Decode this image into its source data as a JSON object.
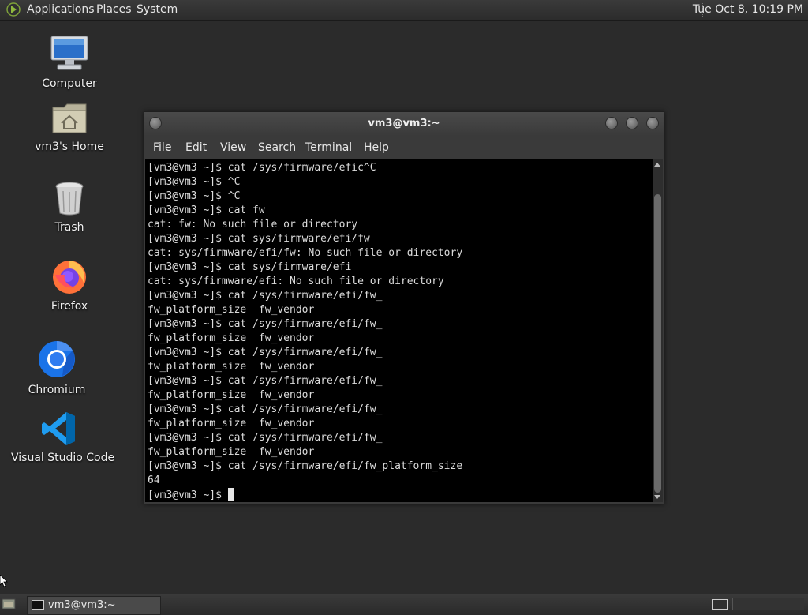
{
  "top_panel": {
    "menus": [
      "Applications",
      "Places",
      "System"
    ],
    "clock": "Tue Oct  8, 10:19 PM"
  },
  "desktop_icons": [
    {
      "label": "Computer",
      "icon": "computer-icon"
    },
    {
      "label": "vm3's Home",
      "icon": "home-folder-icon"
    },
    {
      "label": "Trash",
      "icon": "trash-icon"
    },
    {
      "label": "Firefox",
      "icon": "firefox-icon"
    },
    {
      "label": "Chromium",
      "icon": "chromium-icon"
    },
    {
      "label": "Visual Studio Code",
      "icon": "vscode-icon"
    }
  ],
  "terminal": {
    "title": "vm3@vm3:~",
    "menu": [
      "File",
      "Edit",
      "View",
      "Search",
      "Terminal",
      "Help"
    ],
    "lines": [
      "[vm3@vm3 ~]$ cat /sys/firmware/efic^C",
      "[vm3@vm3 ~]$ ^C",
      "[vm3@vm3 ~]$ ^C",
      "[vm3@vm3 ~]$ cat fw",
      "cat: fw: No such file or directory",
      "[vm3@vm3 ~]$ cat sys/firmware/efi/fw",
      "cat: sys/firmware/efi/fw: No such file or directory",
      "[vm3@vm3 ~]$ cat sys/firmware/efi",
      "cat: sys/firmware/efi: No such file or directory",
      "[vm3@vm3 ~]$ cat /sys/firmware/efi/fw_",
      "fw_platform_size  fw_vendor",
      "[vm3@vm3 ~]$ cat /sys/firmware/efi/fw_",
      "fw_platform_size  fw_vendor",
      "[vm3@vm3 ~]$ cat /sys/firmware/efi/fw_",
      "fw_platform_size  fw_vendor",
      "[vm3@vm3 ~]$ cat /sys/firmware/efi/fw_",
      "fw_platform_size  fw_vendor",
      "[vm3@vm3 ~]$ cat /sys/firmware/efi/fw_",
      "fw_platform_size  fw_vendor",
      "[vm3@vm3 ~]$ cat /sys/firmware/efi/fw_",
      "fw_platform_size  fw_vendor",
      "[vm3@vm3 ~]$ cat /sys/firmware/efi/fw_platform_size",
      "64"
    ],
    "prompt": "[vm3@vm3 ~]$ "
  },
  "taskbar": {
    "task_label": "vm3@vm3:~"
  },
  "colors": {
    "desktop_bg": "#2b2b2b",
    "terminal_bg": "#000000",
    "terminal_fg": "#dcdcdc"
  }
}
